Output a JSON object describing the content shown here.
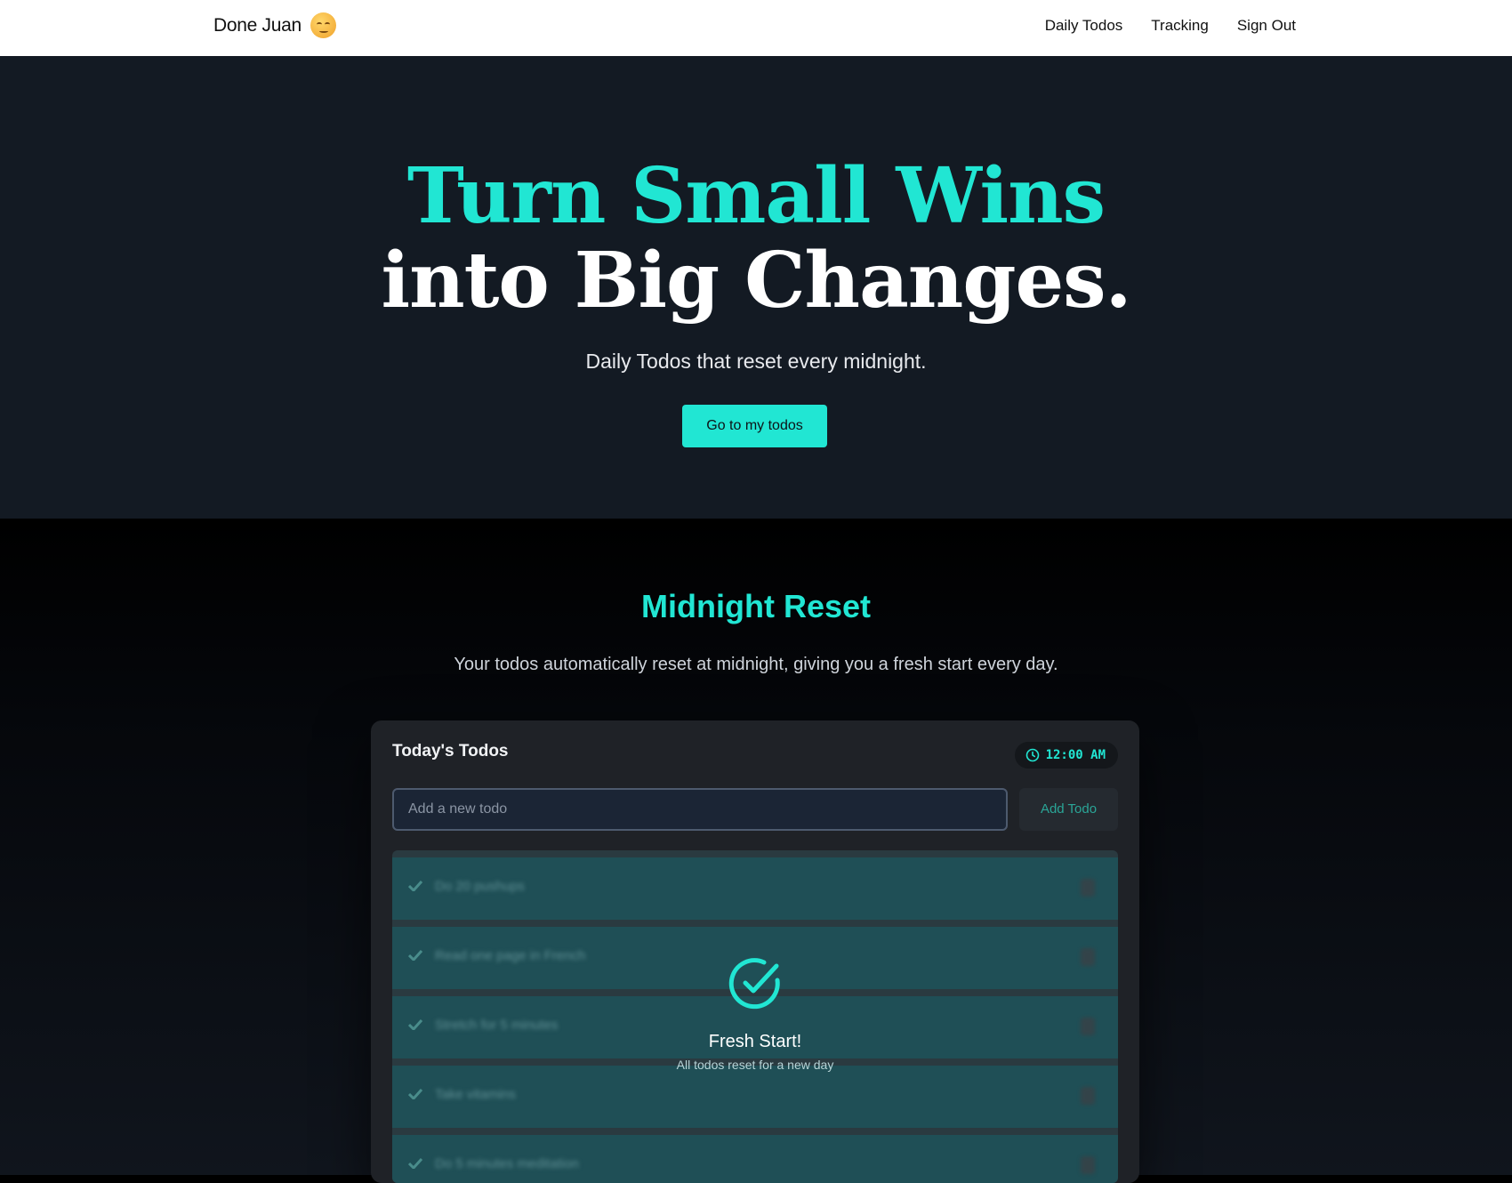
{
  "navbar": {
    "brand": "Done Juan",
    "links": [
      "Daily Todos",
      "Tracking",
      "Sign Out"
    ]
  },
  "hero": {
    "line1": "Turn Small Wins",
    "line2": "into Big Changes.",
    "subtitle": "Daily Todos that reset every midnight.",
    "cta_label": "Go to my todos"
  },
  "reset_section": {
    "title": "Midnight Reset",
    "subtitle": "Your todos automatically reset at midnight, giving you a fresh start every day."
  },
  "todo_card": {
    "title": "Today's Todos",
    "clock": "12:00 AM",
    "input_placeholder": "Add a new todo",
    "add_label": "Add Todo",
    "todos": [
      "Do 20 pushups",
      "Read one page in French",
      "Stretch for 5 minutes",
      "Take vitamins",
      "Do 5 minutes meditation"
    ],
    "overlay_title": "Fresh Start!",
    "overlay_subtitle": "All todos reset for a new day"
  },
  "colors": {
    "accent": "#21e6d3",
    "hero_bg": "#131a23",
    "card_bg": "#1f2227"
  },
  "icons": {
    "clock": "clock-icon",
    "check": "check-circle-icon",
    "row_check": "checkmark-icon",
    "trash": "trash-icon"
  }
}
